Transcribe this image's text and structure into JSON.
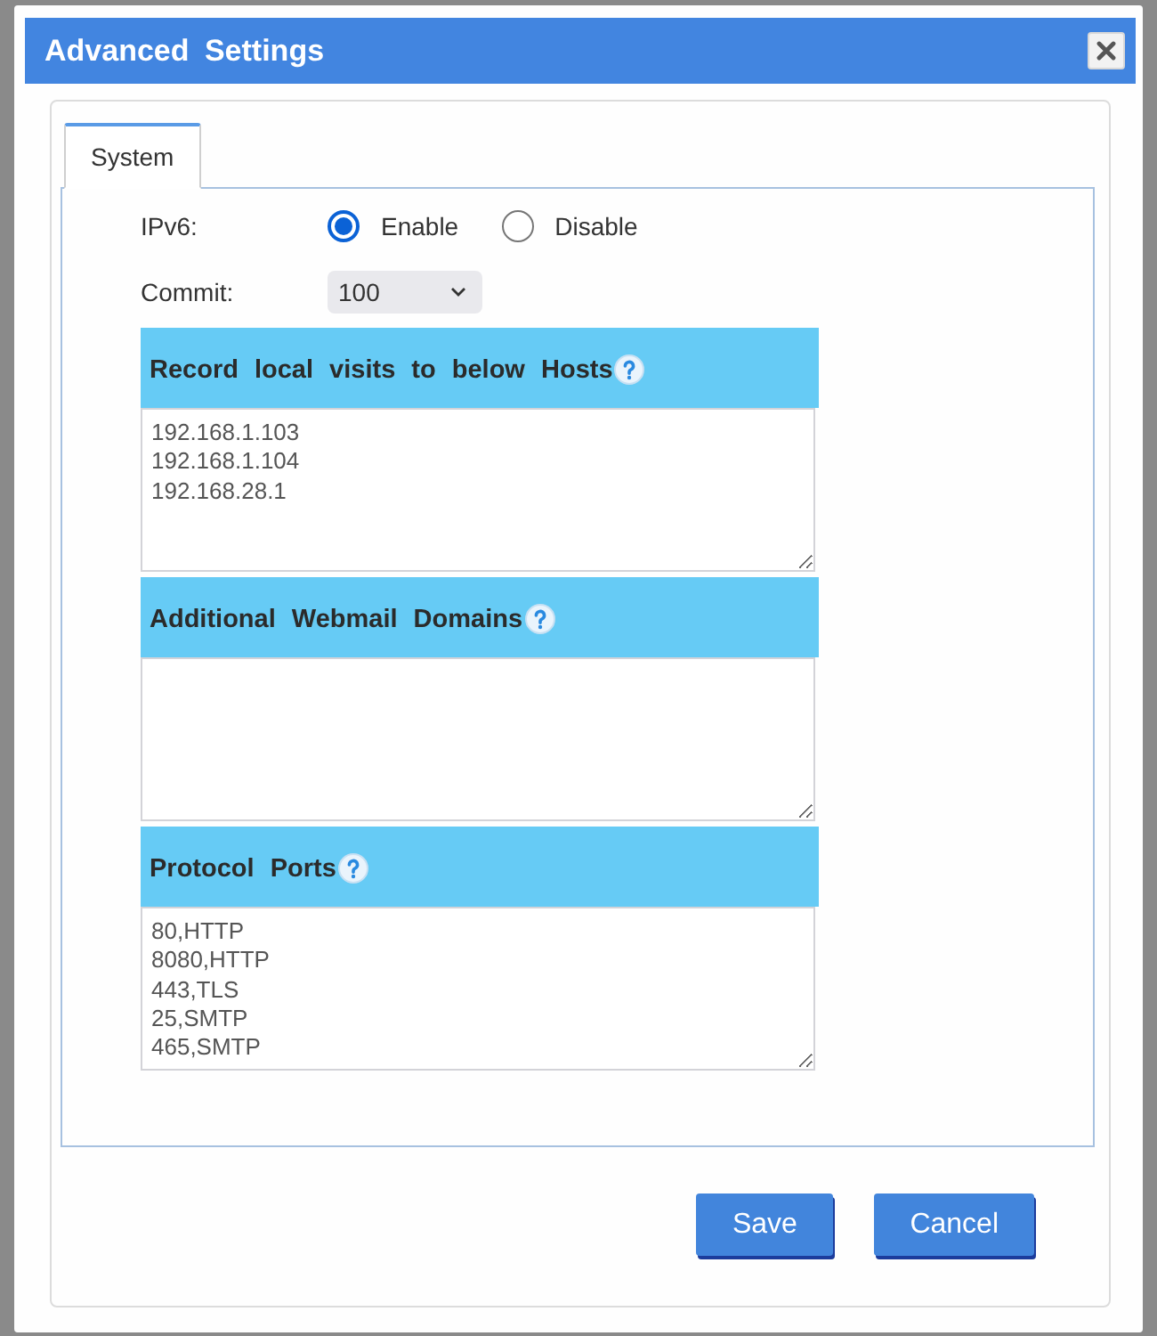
{
  "dialog": {
    "title": "Advanced Settings"
  },
  "tabs": [
    {
      "label": "System",
      "selected": true
    }
  ],
  "ipv6": {
    "label": "IPv6:",
    "options": [
      {
        "label": "Enable",
        "selected": true
      },
      {
        "label": "Disable",
        "selected": false
      }
    ]
  },
  "commit": {
    "label": "Commit:",
    "value": "100"
  },
  "sections": [
    {
      "title": "Record local visits to below Hosts",
      "value": "192.168.1.103\n192.168.1.104\n192.168.28.1"
    },
    {
      "title": "Additional Webmail Domains"
    },
    {
      "title": "Protocol Ports",
      "value": "80,HTTP\n8080,HTTP\n443,TLS\n25,SMTP\n465,SMTP"
    }
  ],
  "buttons": [
    {
      "label": "Save"
    },
    {
      "label": "Cancel"
    }
  ]
}
